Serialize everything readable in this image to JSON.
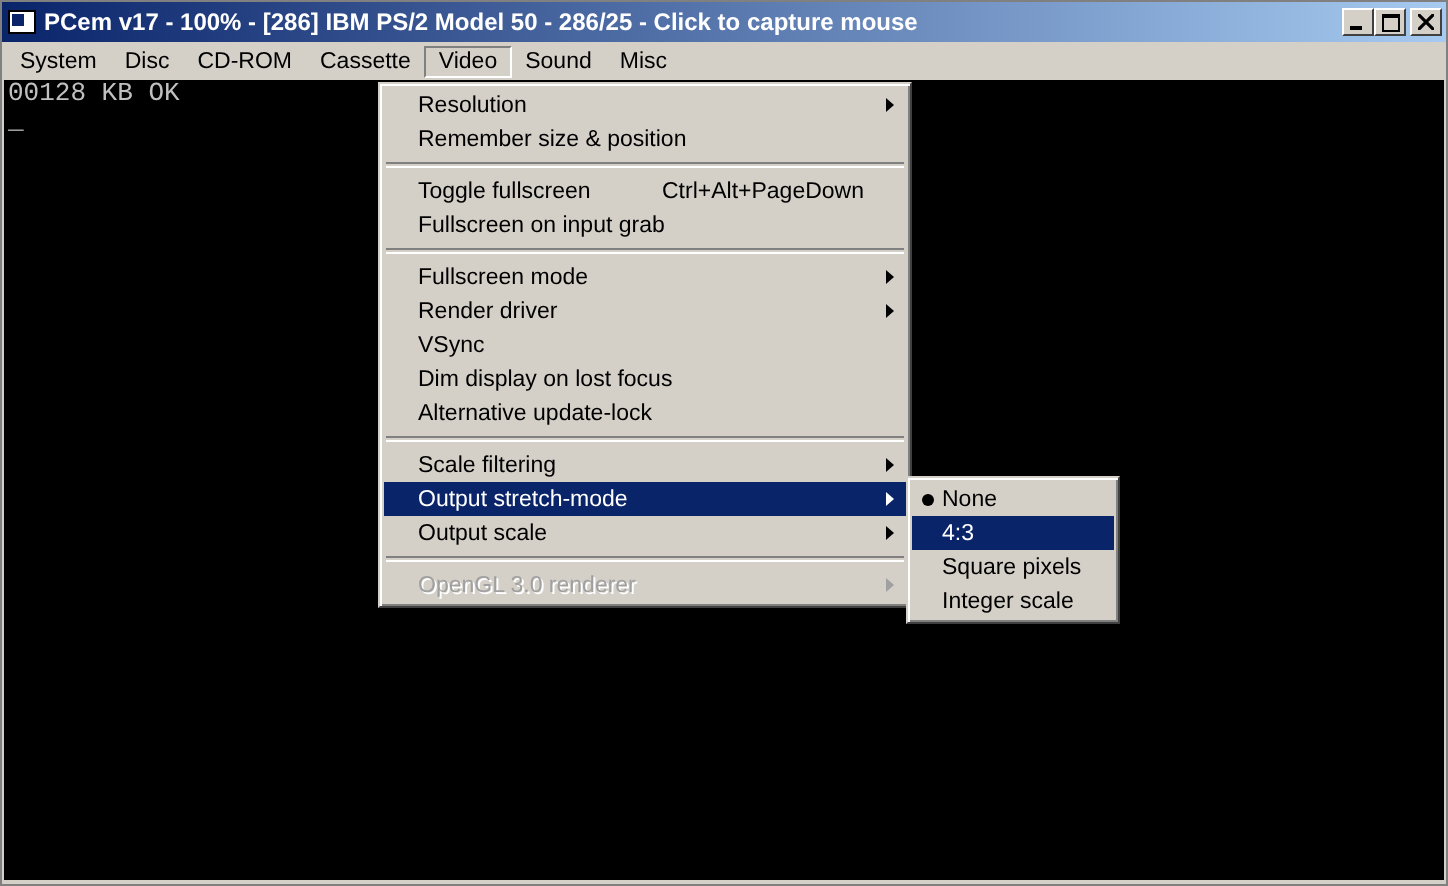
{
  "window": {
    "title": "PCem v17 - 100% - [286] IBM PS/2 Model 50 - 286/25 - Click to capture mouse"
  },
  "menubar": [
    {
      "label": "System",
      "selected": false
    },
    {
      "label": "Disc",
      "selected": false
    },
    {
      "label": "CD-ROM",
      "selected": false
    },
    {
      "label": "Cassette",
      "selected": false
    },
    {
      "label": "Video",
      "selected": true
    },
    {
      "label": "Sound",
      "selected": false
    },
    {
      "label": "Misc",
      "selected": false
    }
  ],
  "screen": {
    "lines": [
      "00128 KB OK",
      "_"
    ]
  },
  "menu": [
    {
      "kind": "item",
      "label": "Resolution",
      "submenu": true,
      "selected": false,
      "disabled": false
    },
    {
      "kind": "item",
      "label": "Remember size & position",
      "submenu": false,
      "selected": false,
      "disabled": false
    },
    {
      "kind": "separator"
    },
    {
      "kind": "item",
      "label": "Toggle fullscreen",
      "shortcut": "Ctrl+Alt+PageDown",
      "submenu": false,
      "selected": false,
      "disabled": false
    },
    {
      "kind": "item",
      "label": "Fullscreen on input grab",
      "submenu": false,
      "selected": false,
      "disabled": false
    },
    {
      "kind": "separator"
    },
    {
      "kind": "item",
      "label": "Fullscreen mode",
      "submenu": true,
      "selected": false,
      "disabled": false
    },
    {
      "kind": "item",
      "label": "Render driver",
      "submenu": true,
      "selected": false,
      "disabled": false
    },
    {
      "kind": "item",
      "label": "VSync",
      "submenu": false,
      "selected": false,
      "disabled": false
    },
    {
      "kind": "item",
      "label": "Dim display on lost focus",
      "submenu": false,
      "selected": false,
      "disabled": false
    },
    {
      "kind": "item",
      "label": "Alternative update-lock",
      "submenu": false,
      "selected": false,
      "disabled": false
    },
    {
      "kind": "separator"
    },
    {
      "kind": "item",
      "label": "Scale filtering",
      "submenu": true,
      "selected": false,
      "disabled": false
    },
    {
      "kind": "item",
      "label": "Output stretch-mode",
      "submenu": true,
      "selected": true,
      "disabled": false
    },
    {
      "kind": "item",
      "label": "Output scale",
      "submenu": true,
      "selected": false,
      "disabled": false
    },
    {
      "kind": "separator"
    },
    {
      "kind": "item",
      "label": "OpenGL 3.0 renderer",
      "submenu": true,
      "selected": false,
      "disabled": true
    }
  ],
  "submenu": [
    {
      "label": "None",
      "checked": true,
      "selected": false
    },
    {
      "label": "4:3",
      "checked": false,
      "selected": true
    },
    {
      "label": "Square pixels",
      "checked": false,
      "selected": false
    },
    {
      "label": "Integer scale",
      "checked": false,
      "selected": false
    }
  ]
}
